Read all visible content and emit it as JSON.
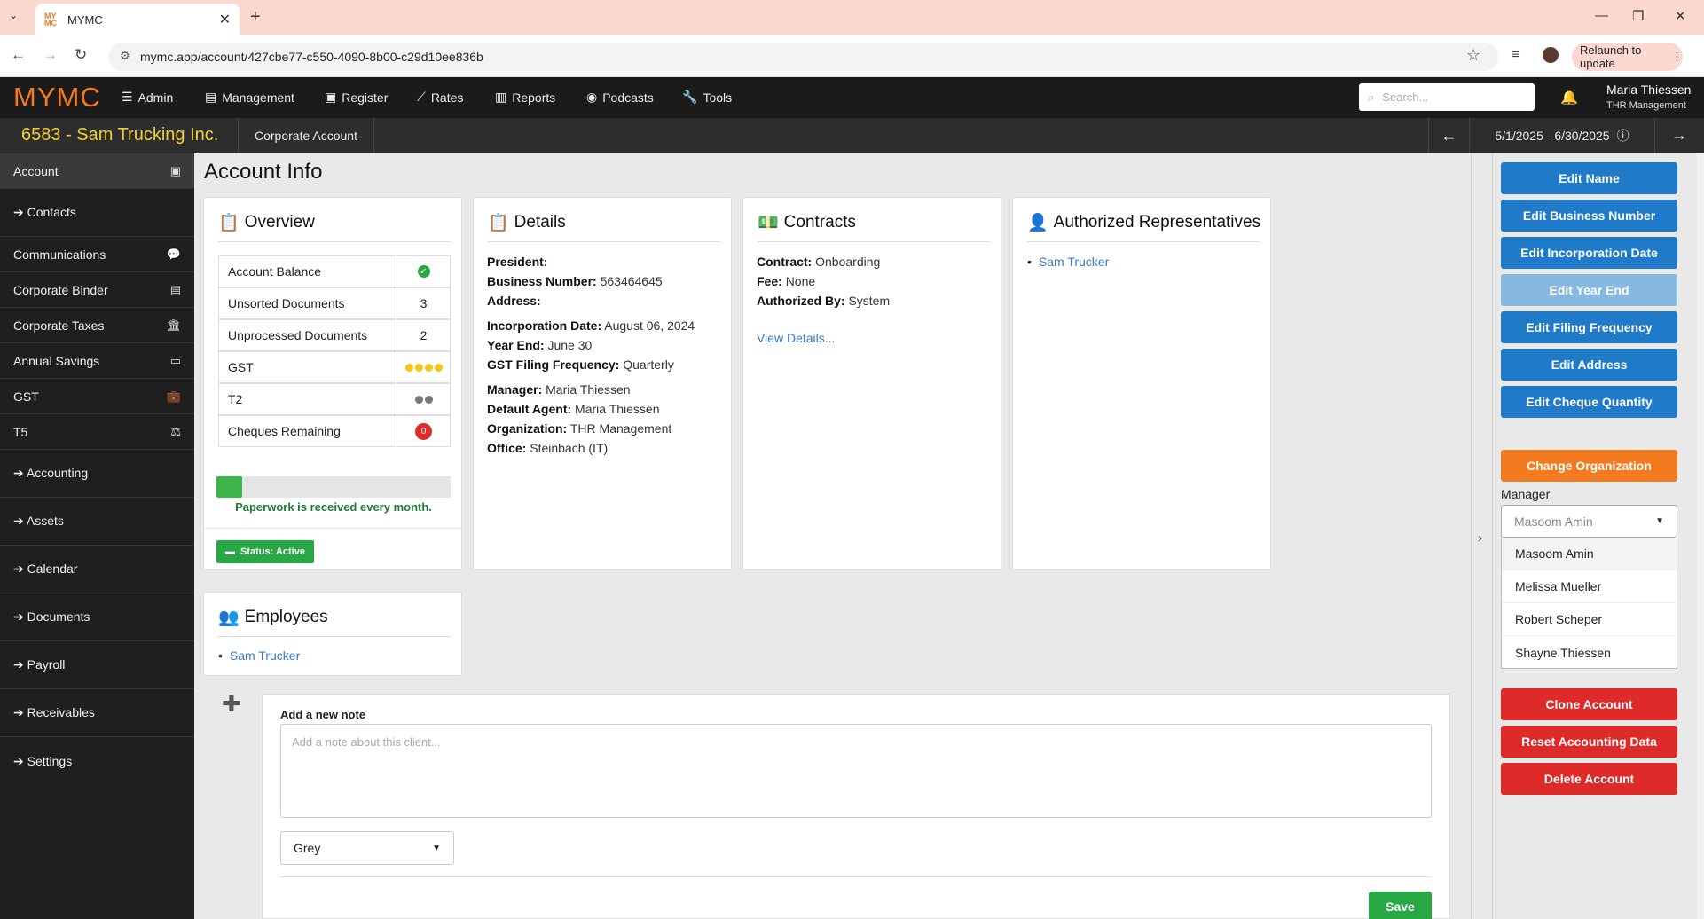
{
  "browser": {
    "tab_title": "MYMC",
    "favicon_text": "MY MC",
    "url": "mymc.app/account/427cbe77-c550-4090-8b00-c29d10ee836b",
    "relaunch_label": "Relaunch to update"
  },
  "app": {
    "logo": "MYMC",
    "nav": [
      {
        "label": "Admin",
        "icon": "table-icon"
      },
      {
        "label": "Management",
        "icon": "clipboard-icon"
      },
      {
        "label": "Register",
        "icon": "id-card-icon"
      },
      {
        "label": "Rates",
        "icon": "line-chart-icon"
      },
      {
        "label": "Reports",
        "icon": "bar-chart-icon"
      },
      {
        "label": "Podcasts",
        "icon": "podcast-icon"
      },
      {
        "label": "Tools",
        "icon": "wrench-icon"
      }
    ],
    "search_placeholder": "Search...",
    "user_name": "Maria Thiessen",
    "user_org": "THR Management"
  },
  "subnav": {
    "account_title": "6583 - Sam Trucking Inc.",
    "corporate_account": "Corporate Account",
    "period": "5/1/2025 - 6/30/2025"
  },
  "sidebar": {
    "items": [
      {
        "label": "Account",
        "icon": "id-card-icon",
        "arrow": false
      },
      {
        "label": "Contacts",
        "icon": "",
        "arrow": true
      },
      {
        "label": "Communications",
        "icon": "comments-icon",
        "arrow": false
      },
      {
        "label": "Corporate Binder",
        "icon": "book-icon",
        "arrow": false
      },
      {
        "label": "Corporate Taxes",
        "icon": "bank-icon",
        "arrow": false
      },
      {
        "label": "Annual Savings",
        "icon": "money-icon",
        "arrow": false
      },
      {
        "label": "GST",
        "icon": "briefcase-icon",
        "arrow": false
      },
      {
        "label": "T5",
        "icon": "balance-scale-icon",
        "arrow": false
      },
      {
        "label": "Accounting",
        "icon": "",
        "arrow": true
      },
      {
        "label": "Assets",
        "icon": "",
        "arrow": true
      },
      {
        "label": "Calendar",
        "icon": "",
        "arrow": true
      },
      {
        "label": "Documents",
        "icon": "",
        "arrow": true
      },
      {
        "label": "Payroll",
        "icon": "",
        "arrow": true
      },
      {
        "label": "Receivables",
        "icon": "",
        "arrow": true
      },
      {
        "label": "Settings",
        "icon": "",
        "arrow": true
      }
    ]
  },
  "page": {
    "title": "Account Info"
  },
  "overview": {
    "title": "Overview",
    "rows": [
      {
        "label": "Account Balance",
        "value": ""
      },
      {
        "label": "Unsorted Documents",
        "value": "3"
      },
      {
        "label": "Unprocessed Documents",
        "value": "2"
      },
      {
        "label": "GST",
        "value": ""
      },
      {
        "label": "T2",
        "value": ""
      },
      {
        "label": "Cheques Remaining",
        "value": "0"
      }
    ],
    "gst_dots": 4,
    "t2_dots": 2,
    "paperwork_progress": 0.11,
    "paperwork_text": "Paperwork is received every month.",
    "status_label": "Status: Active",
    "colors": {
      "green": "#28a745",
      "gold": "#f5c518",
      "grey": "#777777",
      "red": "#df2a2a"
    }
  },
  "details": {
    "title": "Details",
    "president_label": "President:",
    "president": "",
    "business_number_label": "Business Number:",
    "business_number": "563464645",
    "address_label": "Address:",
    "address": "",
    "incorporation_label": "Incorporation Date:",
    "incorporation": "August 06, 2024",
    "year_end_label": "Year End:",
    "year_end": "June 30",
    "gst_freq_label": "GST Filing Frequency:",
    "gst_freq": "Quarterly",
    "manager_label": "Manager:",
    "manager": "Maria Thiessen",
    "agent_label": "Default Agent:",
    "agent": "Maria Thiessen",
    "org_label": "Organization:",
    "org": "THR Management",
    "office_label": "Office:",
    "office": "Steinbach (IT)"
  },
  "contracts": {
    "title": "Contracts",
    "contract_label": "Contract:",
    "contract": "Onboarding",
    "fee_label": "Fee:",
    "fee": "None",
    "auth_label": "Authorized By:",
    "auth": "System",
    "view_details": "View Details..."
  },
  "representatives": {
    "title": "Authorized Representatives",
    "items": [
      "Sam Trucker"
    ]
  },
  "employees": {
    "title": "Employees",
    "items": [
      "Sam Trucker"
    ]
  },
  "notes": {
    "label": "Add a new note",
    "placeholder": "Add a note about this client...",
    "color_value": "Grey",
    "save_label": "Save"
  },
  "actions": {
    "edit_name": "Edit Name",
    "edit_business_number": "Edit Business Number",
    "edit_incorporation_date": "Edit Incorporation Date",
    "edit_year_end": "Edit Year End",
    "edit_filing_frequency": "Edit Filing Frequency",
    "edit_address": "Edit Address",
    "edit_cheque_quantity": "Edit Cheque Quantity",
    "change_organization": "Change Organization",
    "manager_label": "Manager",
    "manager_placeholder": "Masoom Amin",
    "manager_options": [
      "Masoom Amin",
      "Melissa Mueller",
      "Robert Scheper",
      "Shayne Thiessen"
    ],
    "clone_account": "Clone Account",
    "reset_accounting": "Reset Accounting Data",
    "delete_account": "Delete Account"
  }
}
